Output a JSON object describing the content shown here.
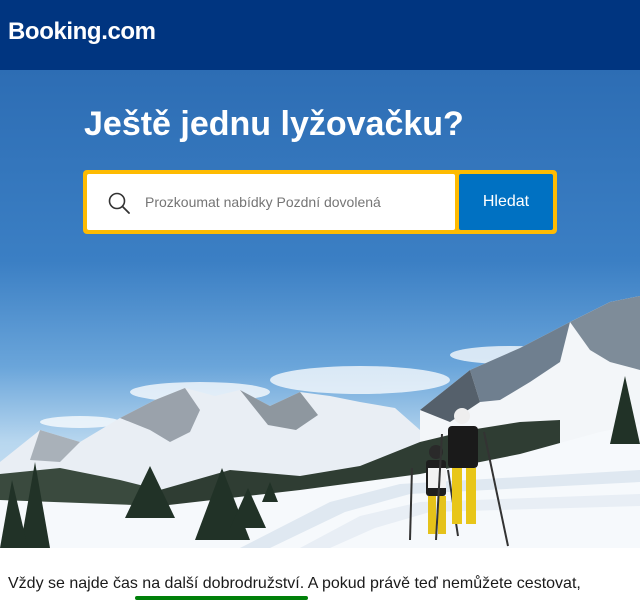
{
  "header": {
    "logo_text": "Booking.com",
    "background_color": "#003580"
  },
  "hero": {
    "headline": "Ještě jednu lyžovačku?",
    "image_description_icon": "cross-country-skiers-photo"
  },
  "search": {
    "placeholder": "Prozkoumat nabídky Pozdní dovolená",
    "button_label": "Hledat",
    "border_color": "#febb02",
    "button_color": "#0071c2",
    "icon": "search-icon"
  },
  "content": {
    "paragraph": "Vždy se najde čas na další dobrodružství. A pokud právě teď nemůžete cestovat,"
  }
}
